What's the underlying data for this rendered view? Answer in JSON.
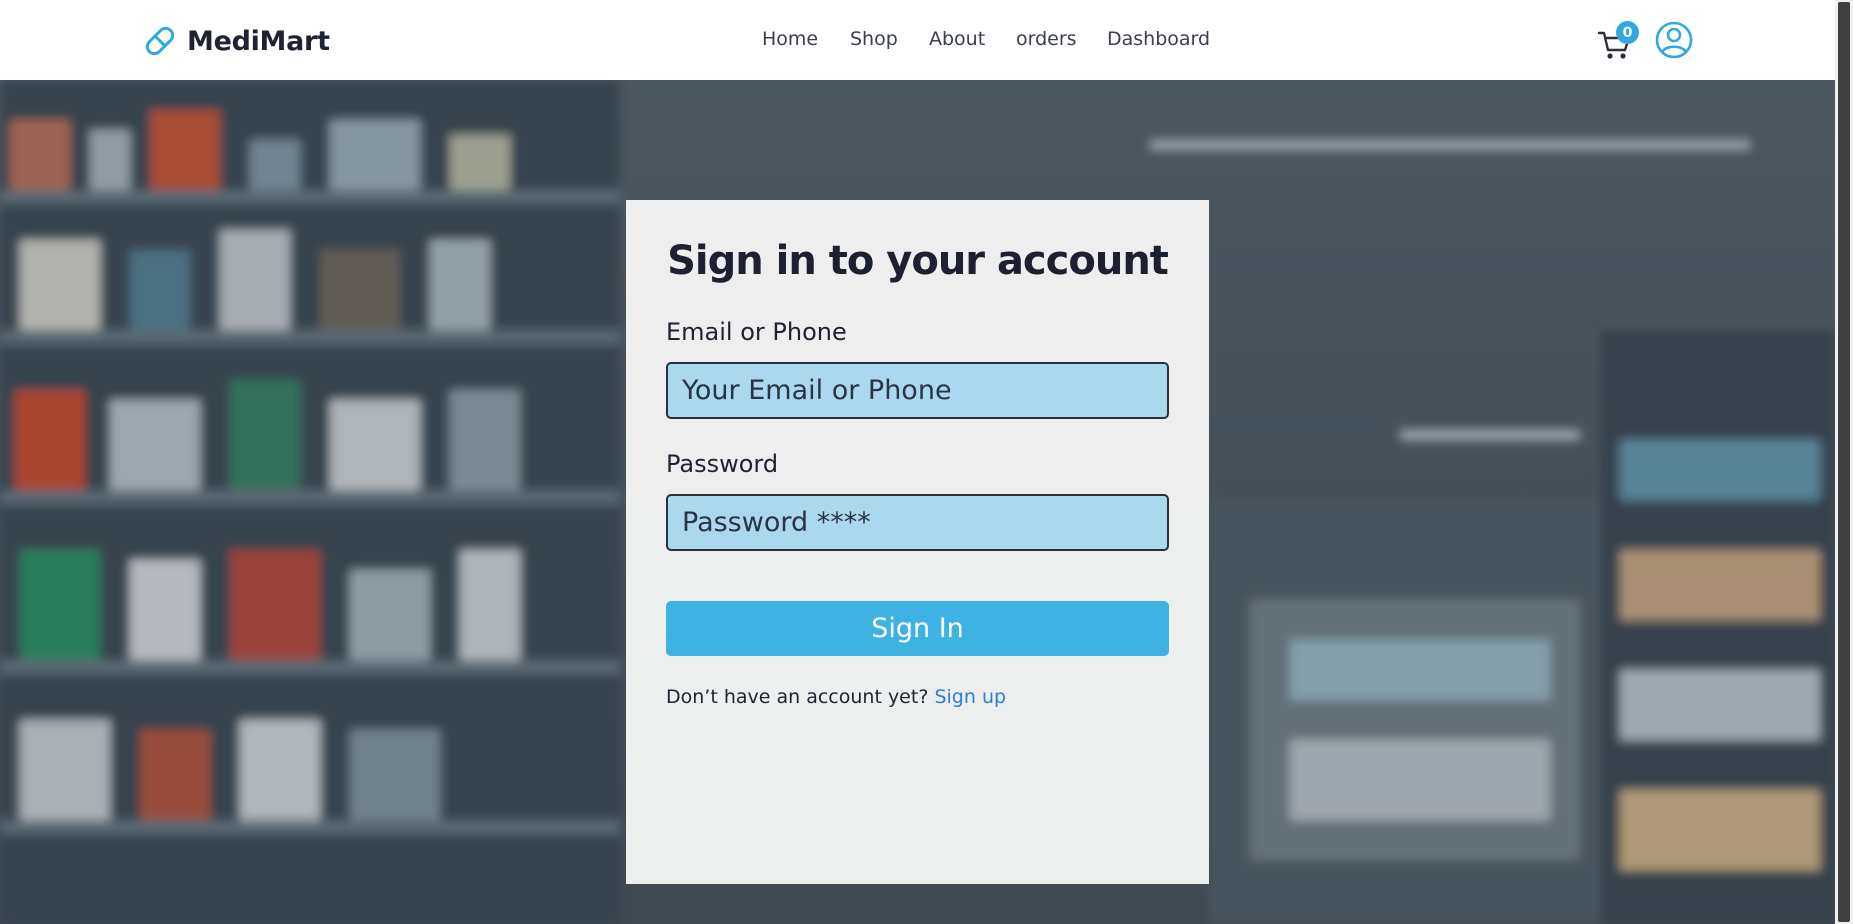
{
  "brand": {
    "name": "MediMart",
    "icon": "pill-icon"
  },
  "nav": {
    "links": [
      {
        "label": "Home"
      },
      {
        "label": "Shop"
      },
      {
        "label": "About"
      },
      {
        "label": "orders"
      },
      {
        "label": "Dashboard"
      }
    ],
    "cart": {
      "icon": "cart-icon",
      "count": "0"
    },
    "profile": {
      "icon": "user-circle-icon"
    }
  },
  "hero": {
    "background": "pharmacy-aisle-photo"
  },
  "signin": {
    "title": "Sign in to your account",
    "email": {
      "label": "Email or Phone",
      "placeholder": "Your Email or Phone",
      "value": ""
    },
    "password": {
      "label": "Password",
      "placeholder": "Password ****",
      "value": ""
    },
    "submit_label": "Sign In",
    "signup_prompt": "Don’t have an account yet?",
    "signup_link": "Sign up"
  },
  "colors": {
    "accent": "#3eb2e3",
    "badge": "#2fa9df",
    "input_bg": "#a9d8ef",
    "link": "#2a7fd4",
    "text_dark": "#1c2030"
  }
}
